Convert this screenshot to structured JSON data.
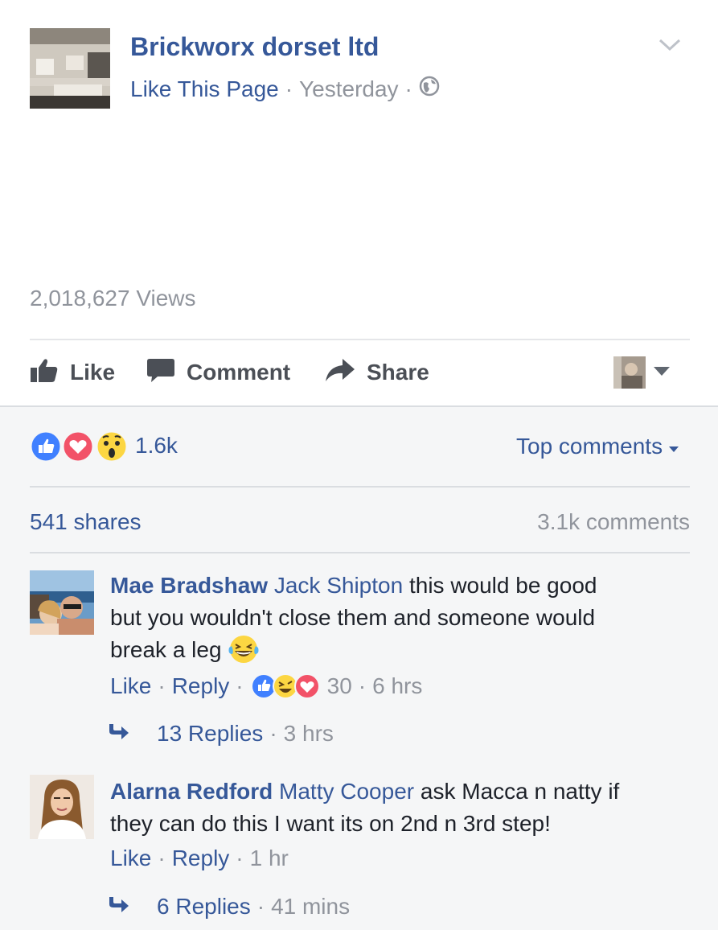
{
  "post": {
    "page_name": "Brickworx dorset ltd",
    "like_page": "Like This Page",
    "time": "Yesterday",
    "separator": "·",
    "views": "2,018,627 Views"
  },
  "actions": {
    "like": "Like",
    "comment": "Comment",
    "share": "Share"
  },
  "summary": {
    "reaction_count": "1.6k",
    "top_comments": "Top comments",
    "shares": "541 shares",
    "comments": "3.1k comments"
  },
  "comments": [
    {
      "author": "Mae Bradshaw",
      "tag": "Jack Shipton",
      "text_line1": " this would be good",
      "text_line2": "but you wouldn't close them and someone would",
      "text_line3": "break a leg ",
      "like": "Like",
      "reply": "Reply",
      "reaction_count": "30",
      "time": "6 hrs",
      "replies": "13 Replies",
      "replies_time": "3 hrs"
    },
    {
      "author": "Alarna Redford",
      "tag": "Matty Cooper",
      "text_line1": " ask Macca n natty if",
      "text_line2": "they can do this I want its on 2nd n 3rd step!",
      "like": "Like",
      "reply": "Reply",
      "time": "1 hr",
      "replies": "6 Replies",
      "replies_time": "41 mins"
    }
  ],
  "colors": {
    "link": "#365899",
    "muted": "#90949c",
    "like_blue": "#4080ff",
    "love_red": "#f25268",
    "wow_yellow": "#fcd642",
    "bg_grey": "#f5f6f7"
  }
}
